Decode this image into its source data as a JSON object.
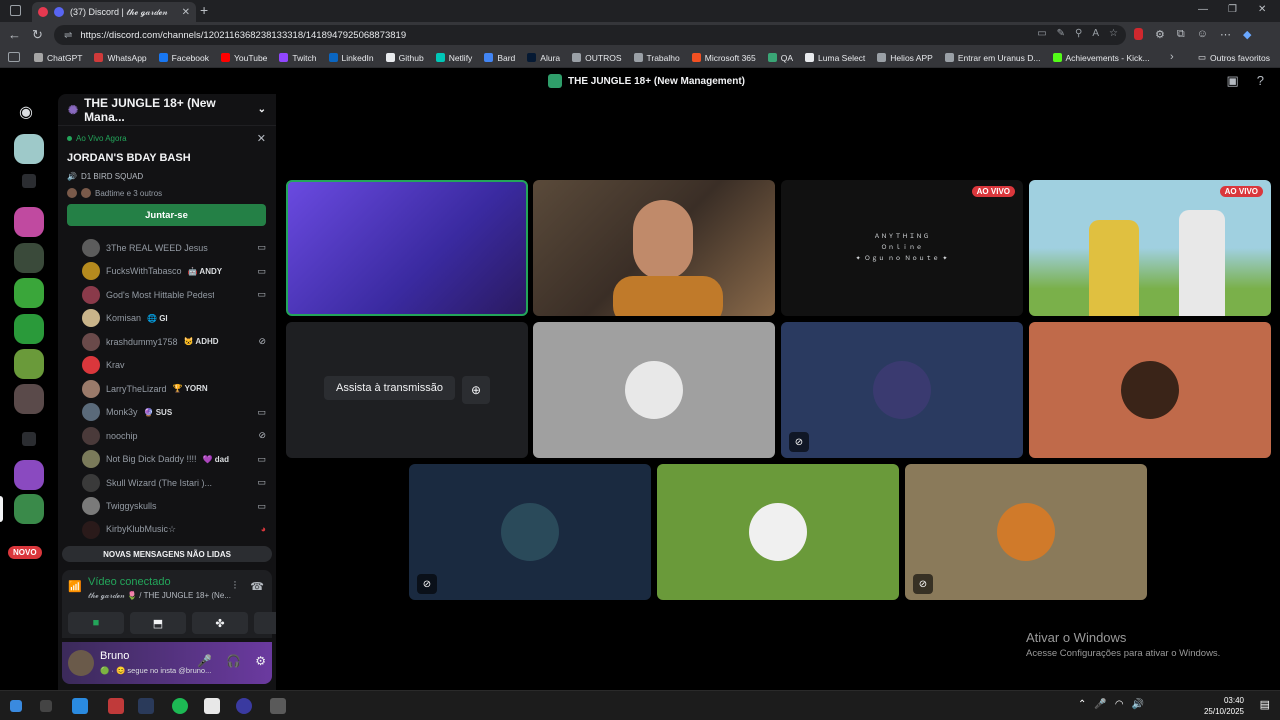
{
  "browser": {
    "tab_title": "(37) Discord | 𝓉𝒽ℯ ℊ𝒶𝓇𝒹ℯ𝓃",
    "url": "https://discord.com/channels/1202116368238133318/1418947925068873819",
    "bookmarks": [
      {
        "label": "ChatGPT",
        "color": "#a5a5a5"
      },
      {
        "label": "WhatsApp",
        "color": "#d03a3a"
      },
      {
        "label": "Facebook",
        "color": "#1877f2"
      },
      {
        "label": "YouTube",
        "color": "#ff0000"
      },
      {
        "label": "Twitch",
        "color": "#9146ff"
      },
      {
        "label": "LinkedIn",
        "color": "#0a66c2"
      },
      {
        "label": "Github",
        "color": "#e8eaed"
      },
      {
        "label": "Netlify",
        "color": "#00c7b7"
      },
      {
        "label": "Bard",
        "color": "#4285f4"
      },
      {
        "label": "Alura",
        "color": "#051933"
      },
      {
        "label": "OUTROS",
        "color": "#9aa0a6"
      },
      {
        "label": "Trabalho",
        "color": "#9aa0a6"
      },
      {
        "label": "Microsoft 365",
        "color": "#f25022"
      },
      {
        "label": "QA",
        "color": "#3aa676"
      },
      {
        "label": "Luma Select",
        "color": "#e8eaed"
      },
      {
        "label": "Helios APP",
        "color": "#9aa0a6"
      },
      {
        "label": "Entrar em Uranus D...",
        "color": "#9aa0a6"
      },
      {
        "label": "Achievements - Kick...",
        "color": "#53fc18"
      }
    ],
    "favorites_label": "Outros favoritos"
  },
  "discord": {
    "title": "THE JUNGLE 18+ (New Management)",
    "server_name": "THE JUNGLE 18+ (New Mana...",
    "live": {
      "tag": "Ao Vivo Agora",
      "title": "JORDAN'S BDAY BASH",
      "channel": "D1 BIRD SQUAD",
      "users": "Badtime e 3 outros",
      "join_label": "Juntar-se"
    },
    "users": [
      {
        "name": "3The REAL WEED Jesus",
        "tag": "",
        "status": "▭",
        "color": "#5c5c5c"
      },
      {
        "name": "FucksWithTabasco",
        "tag": "🤖 ANDY",
        "status": "▭",
        "color": "#b58a1e"
      },
      {
        "name": "God's Most Hittable Pedestri...",
        "tag": "",
        "status": "▭",
        "color": "#8a3a4a"
      },
      {
        "name": "Komisan",
        "tag": "🌐 GI",
        "status": "",
        "color": "#c9b48a"
      },
      {
        "name": "krashdummy1758",
        "tag": "😺 ADHD",
        "status": "⊘",
        "color": "#6a4a4a"
      },
      {
        "name": "Krav",
        "tag": "",
        "status": "",
        "color": "#da373c"
      },
      {
        "name": "LarryTheLizard",
        "tag": "🏆 YORN",
        "status": "",
        "color": "#9a7a6a"
      },
      {
        "name": "Monk3y",
        "tag": "🔮 SUS",
        "status": "▭",
        "color": "#5a6a7a"
      },
      {
        "name": "noochip",
        "tag": "",
        "status": "⊘",
        "color": "#4a3a3a"
      },
      {
        "name": "Not Big Dick Daddy !!!!",
        "tag": "💜 dad",
        "status": "▭",
        "color": "#7a7a5a"
      },
      {
        "name": "Skull Wizard (The Istari )...",
        "tag": "",
        "status": "▭",
        "color": "#3a3a3a"
      },
      {
        "name": "Twiggyskulls",
        "tag": "",
        "status": "▭",
        "color": "#7a7a7a"
      },
      {
        "name": "KirbyKlubMusic☆",
        "tag": "",
        "status": "◕",
        "color": "#2a1a1a"
      }
    ],
    "novo_label": "NOVO",
    "new_messages_label": "NOVAS MENSAGENS NÃO LIDAS",
    "voice": {
      "status": "Vídeo conectado",
      "location": "𝓉𝒽ℯ ℊ𝒶𝓇𝒹ℯ𝓃 🌷 / THE JUNGLE 18+ (Ne..."
    },
    "user": {
      "name": "Bruno",
      "status": "🟢 · 😊 segue no insta @bruno..."
    },
    "stage": {
      "watch_label": "Assista à transmissão",
      "live_badge": "AO VIVO",
      "stream_text": [
        "ＡＮＹＴＨＩＮＧ",
        "Ｏｎｌｉｎｅ",
        "✦ Ｏｇｕ ｎｏ Ｎｏｕｔｅ ✦"
      ]
    }
  },
  "watermark": {
    "line1": "Ativar o Windows",
    "line2": "Acesse Configurações para ativar o Windows."
  },
  "taskbar": {
    "time": "03:40",
    "date": "25/10/2025"
  }
}
